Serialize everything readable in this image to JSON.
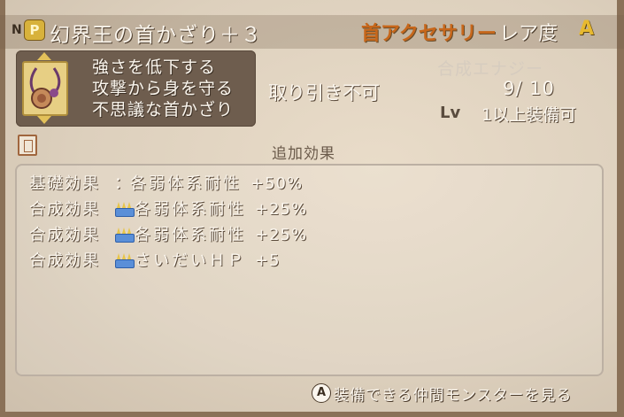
{
  "title": {
    "n_marker": "N",
    "badge_letter": "P",
    "item_name": "幻界王の首かざり＋３",
    "category": "首アクセサリー",
    "rarity_label": "レア度",
    "rarity_value": "A"
  },
  "description": {
    "icon": "necklace-icon",
    "lines": [
      "強さを低下する",
      "攻撃から身を守る",
      "不思議な首かざり"
    ]
  },
  "stats": {
    "tradeable": "取り引き不可",
    "synthesis_label": "合成エナジー",
    "synthesis_value": "9/ 10",
    "lv_label": "Lv",
    "lv_value": "1以上装備可"
  },
  "effects": {
    "header": "追加効果",
    "rows": [
      {
        "type": "基礎効果",
        "mark": "：",
        "crown": false,
        "name": "各弱体系耐性",
        "value": "+50%"
      },
      {
        "type": "合成効果",
        "mark": "",
        "crown": true,
        "name": "各弱体系耐性",
        "value": "+25%"
      },
      {
        "type": "合成効果",
        "mark": "",
        "crown": true,
        "name": "各弱体系耐性",
        "value": "+25%"
      },
      {
        "type": "合成効果",
        "mark": "",
        "crown": true,
        "name": "さいだいＨＰ",
        "value": "+5"
      }
    ]
  },
  "footer": {
    "button_icon": "A",
    "label": "装備できる仲間モンスターを見る"
  },
  "colors": {
    "panel": "#e3d6c3",
    "category": "#c7671b",
    "rarity": "#e7b92f",
    "desc_box": "#6e5d4e"
  }
}
